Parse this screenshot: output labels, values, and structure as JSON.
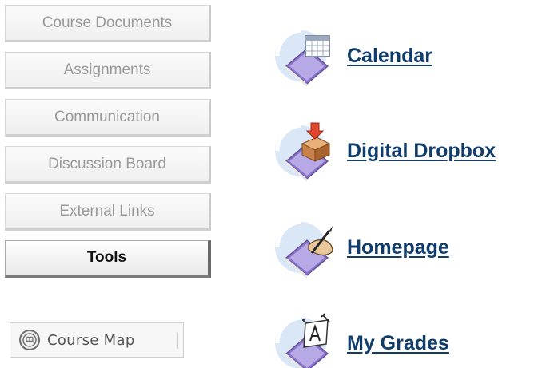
{
  "nav": {
    "items": [
      {
        "label": "Course Documents",
        "active": false
      },
      {
        "label": "Assignments",
        "active": false
      },
      {
        "label": "Communication",
        "active": false
      },
      {
        "label": "Discussion Board",
        "active": false
      },
      {
        "label": "External Links",
        "active": false
      },
      {
        "label": "Tools",
        "active": true
      }
    ]
  },
  "course_map": {
    "label": "Course Map",
    "icon": "course-map-icon"
  },
  "tools": [
    {
      "label": "Calendar",
      "icon": "calendar-icon"
    },
    {
      "label": "Digital Dropbox",
      "icon": "dropbox-icon"
    },
    {
      "label": "Homepage",
      "icon": "homepage-icon"
    },
    {
      "label": "My Grades",
      "icon": "grades-icon"
    }
  ],
  "colors": {
    "link": "#113d6c",
    "button_text_inactive": "#9a9a9a",
    "button_text_active": "#111111",
    "icon_circle": "#cfe0f4",
    "icon_diamond": "#8a70c8"
  }
}
